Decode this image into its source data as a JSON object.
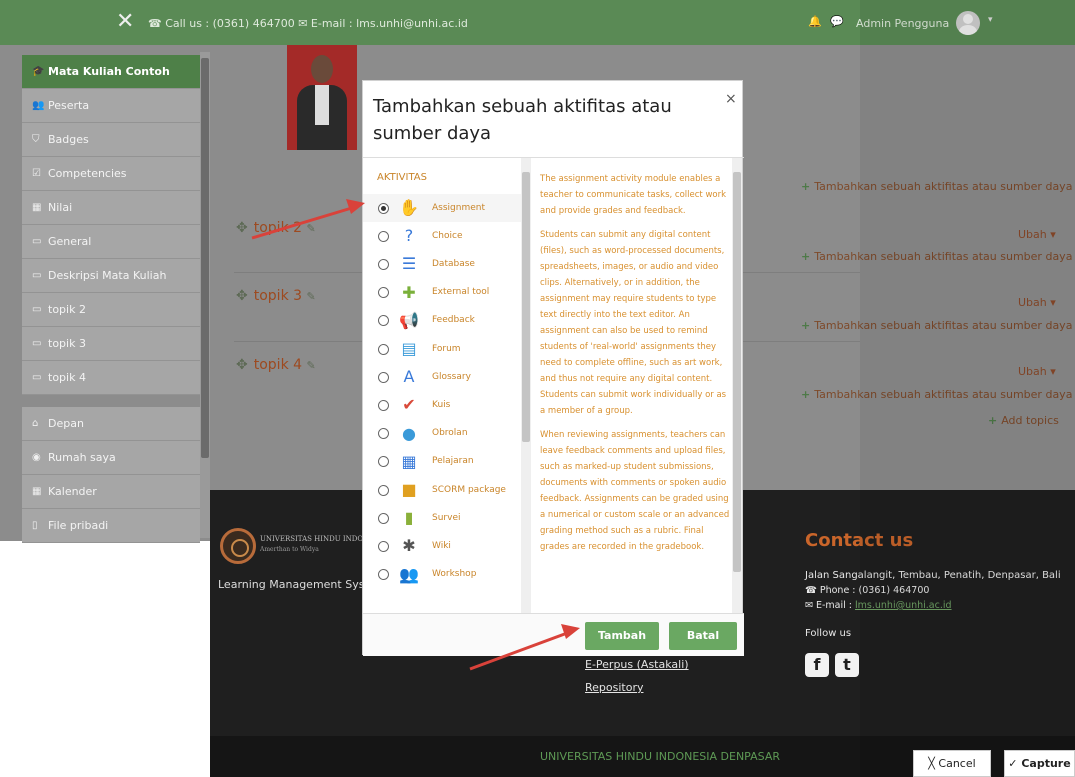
{
  "topbar": {
    "close_glyph": "✕",
    "contact": "☎ Call us : (0361) 464700 ✉ E-mail : lms.unhi@unhi.ac.id",
    "user": "Admin Pengguna",
    "bell_icon": "🔔",
    "chat_icon": "💬"
  },
  "sidebar": {
    "course_items": [
      {
        "label": "Mata Kuliah Contoh",
        "icon": "graduation-cap-icon",
        "glyph": "🎓"
      },
      {
        "label": "Peserta",
        "icon": "users-icon",
        "glyph": "👥"
      },
      {
        "label": "Badges",
        "icon": "shield-icon",
        "glyph": "⛉"
      },
      {
        "label": "Competencies",
        "icon": "checkbox-icon",
        "glyph": "☑"
      },
      {
        "label": "Nilai",
        "icon": "table-icon",
        "glyph": "▦"
      },
      {
        "label": "General",
        "icon": "folder-icon",
        "glyph": "▭"
      },
      {
        "label": "Deskripsi Mata Kuliah",
        "icon": "folder-icon",
        "glyph": "▭"
      },
      {
        "label": "topik 2",
        "icon": "folder-icon",
        "glyph": "▭"
      },
      {
        "label": "topik 3",
        "icon": "folder-icon",
        "glyph": "▭"
      },
      {
        "label": "topik 4",
        "icon": "folder-icon",
        "glyph": "▭"
      }
    ],
    "site_items": [
      {
        "label": "Depan",
        "icon": "home-icon",
        "glyph": "⌂"
      },
      {
        "label": "Rumah saya",
        "icon": "dashboard-icon",
        "glyph": "◉"
      },
      {
        "label": "Kalender",
        "icon": "calendar-icon",
        "glyph": "▦"
      },
      {
        "label": "File pribadi",
        "icon": "file-icon",
        "glyph": "▯"
      }
    ]
  },
  "main": {
    "topics": [
      "topik 2",
      "topik 3",
      "topik 4"
    ],
    "add_activity": "Tambahkan sebuah aktifitas atau sumber daya",
    "ubah": "Ubah",
    "add_topics": "Add topics"
  },
  "footer": {
    "uni_name": "UNIVERSITAS HINDU INDONESIA",
    "motto": "Amerthan to Widya",
    "lms": "Learning Management Syst",
    "links": [
      "E-Perpus (Astakali)",
      "Repository"
    ],
    "contact_title": "Contact us",
    "address": "Jalan Sangalangit, Tembau, Penatih, Denpasar, Bali",
    "phone": "Phone : (0361) 464700",
    "email_label": "E-mail : ",
    "email": "lms.unhi@unhi.ac.id",
    "follow": "Follow us",
    "bottom": "UNIVERSITAS HINDU INDONESIA DENPASAR"
  },
  "modal": {
    "title": "Tambahkan sebuah aktifitas atau sumber daya",
    "close": "×",
    "section": "AKTIVITAS",
    "options": [
      {
        "label": "Assignment",
        "icon": "assignment-icon",
        "glyph": "✋",
        "color": "#d9783a",
        "selected": true
      },
      {
        "label": "Choice",
        "icon": "choice-icon",
        "glyph": "?",
        "color": "#3a7ad9",
        "selected": false
      },
      {
        "label": "Database",
        "icon": "database-icon",
        "glyph": "☰",
        "color": "#3a7ad9",
        "selected": false
      },
      {
        "label": "External tool",
        "icon": "puzzle-icon",
        "glyph": "✚",
        "color": "#7ab03a",
        "selected": false
      },
      {
        "label": "Feedback",
        "icon": "megaphone-icon",
        "glyph": "📢",
        "color": "#d9783a",
        "selected": false
      },
      {
        "label": "Forum",
        "icon": "forum-icon",
        "glyph": "▤",
        "color": "#3a9ad9",
        "selected": false
      },
      {
        "label": "Glossary",
        "icon": "glossary-icon",
        "glyph": "A",
        "color": "#3a7ad9",
        "selected": false
      },
      {
        "label": "Kuis",
        "icon": "quiz-icon",
        "glyph": "✔",
        "color": "#d94a3a",
        "selected": false
      },
      {
        "label": "Obrolan",
        "icon": "chat-icon",
        "glyph": "●",
        "color": "#3a9ad9",
        "selected": false
      },
      {
        "label": "Pelajaran",
        "icon": "lesson-icon",
        "glyph": "▦",
        "color": "#3a7ad9",
        "selected": false
      },
      {
        "label": "SCORM package",
        "icon": "scorm-icon",
        "glyph": "■",
        "color": "#e0a020",
        "selected": false
      },
      {
        "label": "Survei",
        "icon": "survey-icon",
        "glyph": "▮",
        "color": "#8ab03a",
        "selected": false
      },
      {
        "label": "Wiki",
        "icon": "wiki-icon",
        "glyph": "✱",
        "color": "#555555",
        "selected": false
      },
      {
        "label": "Workshop",
        "icon": "workshop-icon",
        "glyph": "👥",
        "color": "#d9a020",
        "selected": false
      }
    ],
    "description": [
      "The assignment activity module enables a teacher to communicate tasks, collect work and provide grades and feedback.",
      "Students can submit any digital content (files), such as word-processed documents, spreadsheets, images, or audio and video clips. Alternatively, or in addition, the assignment may require students to type text directly into the text editor. An assignment can also be used to remind students of 'real-world' assignments they need to complete offline, such as art work, and thus not require any digital content. Students can submit work individually or as a member of a group.",
      "When reviewing assignments, teachers can leave feedback comments and upload files, such as marked-up student submissions, documents with comments or spoken audio feedback. Assignments can be graded using a numerical or custom scale or an advanced grading method such as a rubric. Final grades are recorded in the gradebook."
    ],
    "add_button": "Tambah",
    "cancel_button": "Batal"
  },
  "capture_bar": {
    "cancel": "╳ Cancel",
    "capture": "✓ Capture"
  },
  "colors": {
    "accent_green": "#5a8a55",
    "button_green": "#6aa862",
    "link_orange": "#c9852a",
    "arrow_red": "#d9423a"
  }
}
